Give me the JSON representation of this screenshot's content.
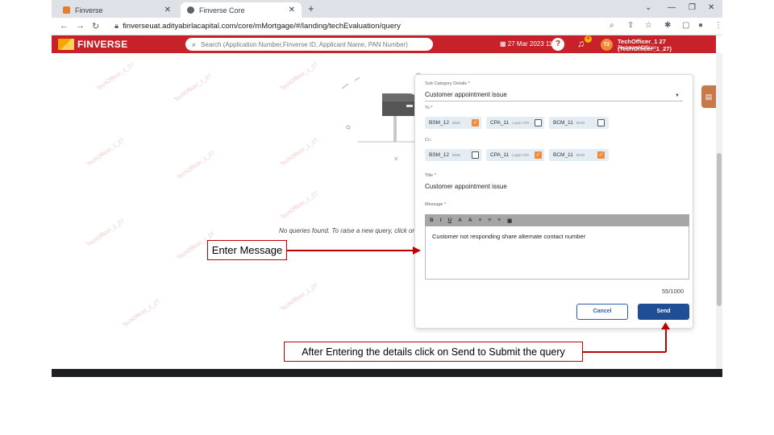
{
  "browser": {
    "tabs": [
      {
        "label": "Finverse",
        "icon": "finverse-favicon"
      },
      {
        "label": "Finverse Core",
        "icon": "globe-icon"
      }
    ],
    "url": "finverseuat.adityabirlacapital.com/core/mMortgage/#/landing/techEvaluation/query"
  },
  "header": {
    "brand": "FINVERSE",
    "search_placeholder": "Search (Application Number,Finverse ID, Applicant Name, PAN Number)",
    "datetime": "27 Mar 2023 11:45",
    "notification_count": "4",
    "avatar_initials": "T2",
    "user_name": "TechOfficer_1 27 (TechOfficer_1_27)",
    "user_role": "Technical Officer",
    "accent_color": "#c7222a"
  },
  "main": {
    "empty_message": "No queries found. To raise a new query, click on '",
    "watermark": "TechOfficer_1_27"
  },
  "query_form": {
    "sub_category_label": "Sub Category Details *",
    "sub_category_value": "Customer appointment issue",
    "to_label": "To *",
    "to_recipients": [
      {
        "name": "BSM_12",
        "role": "BSM",
        "checked": true
      },
      {
        "name": "CPA_11",
        "role": "Login CPA",
        "checked": false
      },
      {
        "name": "BCM_11",
        "role": "BCM",
        "checked": false
      }
    ],
    "cc_label": "Cc:",
    "cc_recipients": [
      {
        "name": "BSM_12",
        "role": "BSM",
        "checked": false
      },
      {
        "name": "CPA_11",
        "role": "Login CPA",
        "checked": true
      },
      {
        "name": "BCM_11",
        "role": "BCM",
        "checked": true
      }
    ],
    "title_label": "Title *",
    "title_value": "Customer appointment issue",
    "message_label": "Message *",
    "toolbar": [
      "B",
      "I",
      "U",
      "A",
      "A",
      "≡",
      "≡",
      "≡",
      "▣"
    ],
    "message_value": "Customer not responding share alternate contact number",
    "char_counter": "55/1000",
    "cancel_label": "Cancel",
    "send_label": "Send"
  },
  "annotations": {
    "enter_message": "Enter Message",
    "send_hint": "After Entering the details click on Send to Submit the query"
  }
}
